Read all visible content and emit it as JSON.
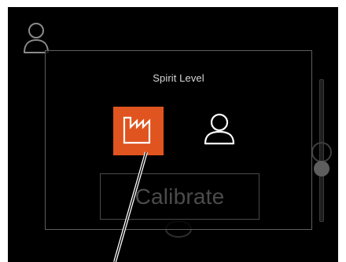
{
  "dialog": {
    "title": "Spirit Level",
    "modes": [
      {
        "name": "machine",
        "icon": "factory-icon",
        "selected": true
      },
      {
        "name": "user",
        "icon": "user-icon",
        "selected": false
      }
    ],
    "calibrate_label": "Calibrate"
  },
  "background": {
    "icon": "user-icon"
  },
  "colors": {
    "screen_bg": "#000000",
    "accent": "#e0541f",
    "modal_border": "#5e5e5e",
    "title_text": "#d6d6d6",
    "disabled_text": "#4b4b4b"
  }
}
